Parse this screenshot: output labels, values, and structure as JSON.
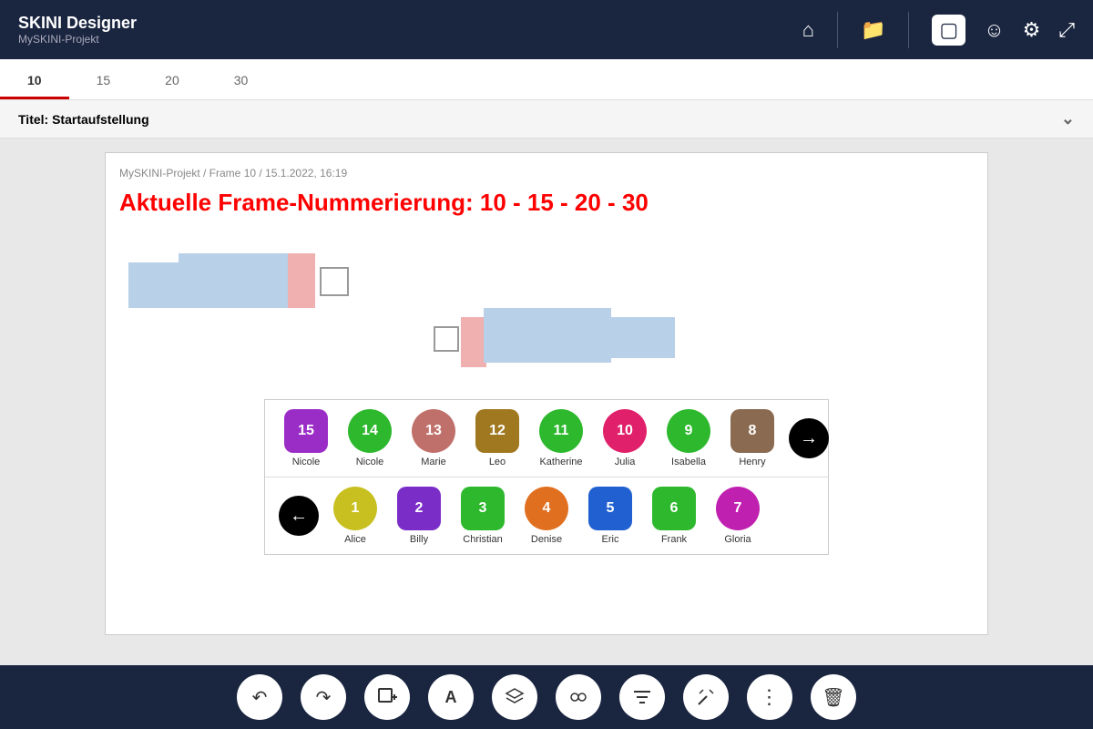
{
  "app": {
    "name": "SKINI Designer",
    "subtitle": "MySKINI-Projekt"
  },
  "header": {
    "icons": [
      "home",
      "folder",
      "screen",
      "face",
      "settings",
      "fullscreen"
    ]
  },
  "tabs": [
    {
      "label": "10",
      "active": true
    },
    {
      "label": "15",
      "active": false
    },
    {
      "label": "20",
      "active": false
    },
    {
      "label": "30",
      "active": false
    }
  ],
  "titel": {
    "label": "Titel:",
    "value": "Startaufstellung"
  },
  "canvas": {
    "meta": "MySKINI-Projekt / Frame 10 / 15.1.2022, 16:19",
    "frame_title": "Aktuelle Frame-Nummerierung: 10 - 15 - 20 - 30"
  },
  "players_row1": [
    {
      "number": "15",
      "name": "Nicole",
      "color": "#9b2dc7",
      "shape": "rounded"
    },
    {
      "number": "14",
      "name": "Nicole",
      "color": "#2db82d",
      "shape": "circle"
    },
    {
      "number": "13",
      "name": "Marie",
      "color": "#c0706a",
      "shape": "circle"
    },
    {
      "number": "12",
      "name": "Leo",
      "color": "#a07820",
      "shape": "rounded"
    },
    {
      "number": "11",
      "name": "Katherine",
      "color": "#2db82d",
      "shape": "circle"
    },
    {
      "number": "10",
      "name": "Julia",
      "color": "#e0206a",
      "shape": "circle"
    },
    {
      "number": "9",
      "name": "Isabella",
      "color": "#2db82d",
      "shape": "circle"
    },
    {
      "number": "8",
      "name": "Henry",
      "color": "#8a6a50",
      "shape": "rounded"
    }
  ],
  "players_row2": [
    {
      "number": "1",
      "name": "Alice",
      "color": "#c8c020",
      "shape": "circle"
    },
    {
      "number": "2",
      "name": "Billy",
      "color": "#7b2dc7",
      "shape": "rounded"
    },
    {
      "number": "3",
      "name": "Christian",
      "color": "#2db82d",
      "shape": "rounded"
    },
    {
      "number": "4",
      "name": "Denise",
      "color": "#e07020",
      "shape": "circle"
    },
    {
      "number": "5",
      "name": "Eric",
      "color": "#2060d0",
      "shape": "rounded"
    },
    {
      "number": "6",
      "name": "Frank",
      "color": "#2db82d",
      "shape": "rounded"
    },
    {
      "number": "7",
      "name": "Gloria",
      "color": "#c020b0",
      "shape": "circle"
    }
  ],
  "toolbar_buttons": [
    "undo",
    "redo",
    "add-frame",
    "text",
    "layers",
    "group",
    "filter",
    "tools",
    "more",
    "delete"
  ]
}
